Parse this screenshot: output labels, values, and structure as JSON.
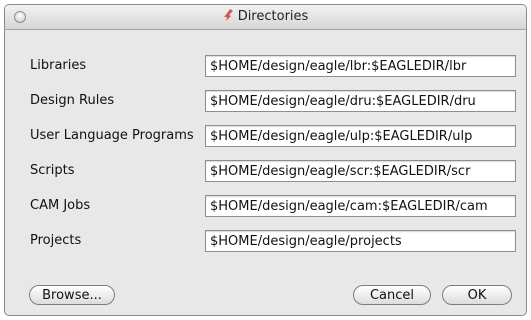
{
  "window": {
    "title": "Directories"
  },
  "rows": [
    {
      "label": "Libraries",
      "value": "$HOME/design/eagle/lbr:$EAGLEDIR/lbr"
    },
    {
      "label": "Design Rules",
      "value": "$HOME/design/eagle/dru:$EAGLEDIR/dru"
    },
    {
      "label": "User Language Programs",
      "value": "$HOME/design/eagle/ulp:$EAGLEDIR/ulp"
    },
    {
      "label": "Scripts",
      "value": "$HOME/design/eagle/scr:$EAGLEDIR/scr"
    },
    {
      "label": "CAM Jobs",
      "value": "$HOME/design/eagle/cam:$EAGLEDIR/cam"
    },
    {
      "label": "Projects",
      "value": "$HOME/design/eagle/projects"
    }
  ],
  "buttons": {
    "browse": "Browse...",
    "cancel": "Cancel",
    "ok": "OK"
  },
  "icons": {
    "title_icon": "eagle-icon",
    "close": "close-dot-icon"
  },
  "colors": {
    "window_bg": "#e8e8e8",
    "title_icon": "#d9534f"
  }
}
